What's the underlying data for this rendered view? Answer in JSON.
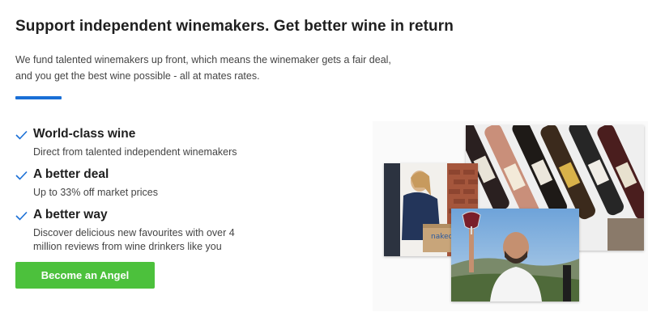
{
  "headline": "Support independent winemakers. Get better wine in return",
  "intro": "We fund talented winemakers up front, which means the winemaker gets a fair deal, and you get the best wine possible - all at mates rates.",
  "features": [
    {
      "title": "World-class wine",
      "desc": "Direct from talented independent winemakers"
    },
    {
      "title": "A better deal",
      "desc": "Up to 33% off market prices"
    },
    {
      "title": "A better way",
      "desc": "Discover delicious new favourites with over 4 million reviews from wine drinkers like you"
    }
  ],
  "cta": {
    "label": "Become an Angel"
  },
  "collage": {
    "box_label": "naked"
  },
  "colors": {
    "accent": "#1a6fd6",
    "cta": "#4cc13c",
    "check": "#1a6fd6"
  }
}
